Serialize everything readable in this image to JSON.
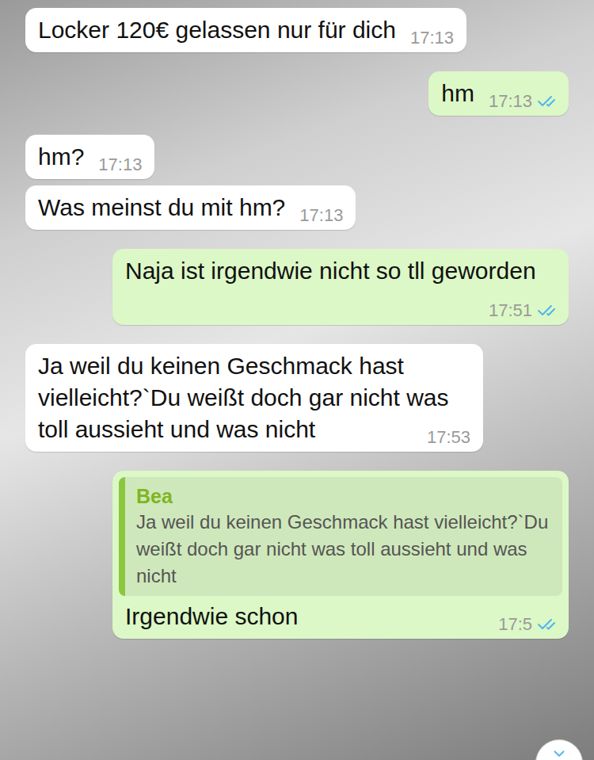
{
  "chat": {
    "messages": [
      {
        "kind": "incoming",
        "text": "Locker 120€ gelassen nur für dich",
        "time": "17:13"
      },
      {
        "kind": "outgoing",
        "text": "hm",
        "time": "17:13",
        "read": true
      },
      {
        "kind": "incoming",
        "text": "hm?",
        "time": "17:13"
      },
      {
        "kind": "incoming",
        "text": "Was meinst du mit hm?",
        "time": "17:13"
      },
      {
        "kind": "outgoing",
        "text": "Naja ist irgendwie nicht so tll geworden",
        "time": "17:51",
        "read": true
      },
      {
        "kind": "incoming",
        "text": "Ja weil du keinen Geschmack hast vielleicht?`Du weißt doch gar nicht was toll aussieht und was nicht",
        "time": "17:53"
      },
      {
        "kind": "outgoing",
        "text": "Irgendwie schon",
        "time": "17:5",
        "read": true,
        "quote": {
          "author": "Bea",
          "text": "Ja weil du keinen Geschmack hast vielleicht?`Du weißt doch gar nicht was toll aussieht und was nicht"
        }
      }
    ]
  }
}
